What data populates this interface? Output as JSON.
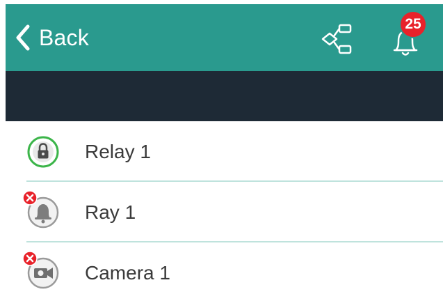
{
  "header": {
    "back_label": "Back",
    "notification_count": "25",
    "background_color": "#2a9a8e",
    "subbar_color": "#1e2a36"
  },
  "devices": [
    {
      "label": "Relay 1",
      "icon": "lock-icon",
      "status": "ok"
    },
    {
      "label": "Ray 1",
      "icon": "bell-icon",
      "status": "error"
    },
    {
      "label": "Camera 1",
      "icon": "camera-icon",
      "status": "error"
    }
  ],
  "colors": {
    "ok_ring": "#3cb54a",
    "error_badge": "#e8222a",
    "divider": "#bfe3dd"
  }
}
